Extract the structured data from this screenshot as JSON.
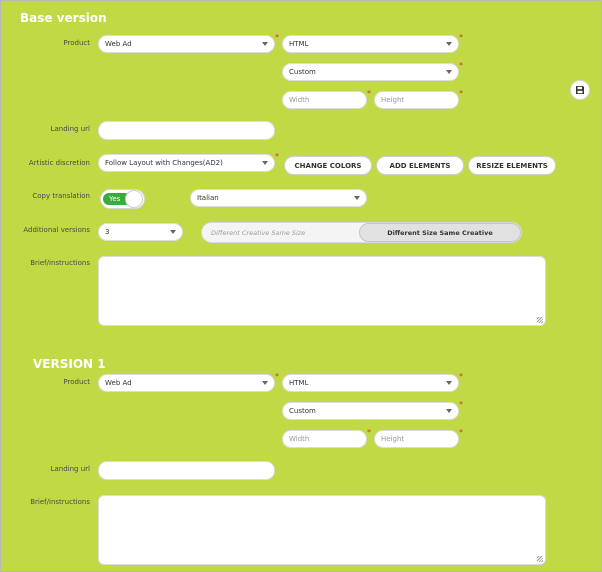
{
  "base": {
    "title": "Base version",
    "product": {
      "label": "Product",
      "type_value": "Web Ad",
      "format_value": "HTML",
      "size_value": "Custom",
      "width_placeholder": "Width",
      "height_placeholder": "Height"
    },
    "landing_url": {
      "label": "Landing url",
      "value": ""
    },
    "artistic": {
      "label": "Artistic discretion",
      "value": "Follow Layout with Changes(AD2)",
      "buttons": [
        "CHANGE COLORS",
        "ADD ELEMENTS",
        "RESIZE ELEMENTS"
      ]
    },
    "copy_translation": {
      "label": "Copy translation",
      "toggle_label": "Yes",
      "language": "Italian"
    },
    "additional_versions": {
      "label": "Additional versions",
      "value": "3",
      "options": [
        "Different Creative Same Size",
        "Different Size Same Creative"
      ],
      "selected": "Different Size Same Creative"
    },
    "brief": {
      "label": "Brief/instructions"
    }
  },
  "version1": {
    "title": "VERSION 1",
    "product": {
      "label": "Product",
      "type_value": "Web Ad",
      "format_value": "HTML",
      "size_value": "Custom",
      "width_placeholder": "Width",
      "height_placeholder": "Height"
    },
    "landing_url": {
      "label": "Landing url"
    },
    "brief": {
      "label": "Brief/instructions"
    }
  },
  "required_marker": "*",
  "icons": [
    "save-icon"
  ],
  "colors": {
    "background": "#c1d945",
    "toggle_on": "#3bab3b",
    "required": "#dd3333"
  }
}
